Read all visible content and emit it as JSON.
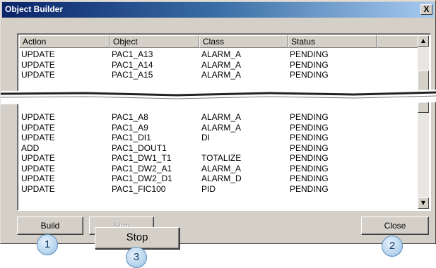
{
  "window": {
    "title": "Object Builder",
    "close_glyph": "X"
  },
  "columns": [
    "Action",
    "Object",
    "Class",
    "Status",
    ""
  ],
  "rows_top": [
    [
      "UPDATE",
      "PAC1_A13",
      "ALARM_A",
      "PENDING"
    ],
    [
      "UPDATE",
      "PAC1_A14",
      "ALARM_A",
      "PENDING"
    ],
    [
      "UPDATE",
      "PAC1_A15",
      "ALARM_A",
      "PENDING"
    ]
  ],
  "rows_bottom": [
    [
      "UPDATE",
      "PAC1_A8",
      "ALARM_A",
      "PENDING"
    ],
    [
      "UPDATE",
      "PAC1_A9",
      "ALARM_A",
      "PENDING"
    ],
    [
      "UPDATE",
      "PAC1_DI1",
      "DI",
      "PENDING"
    ],
    [
      "ADD",
      "PAC1_DOUT1",
      "",
      "PENDING"
    ],
    [
      "UPDATE",
      "PAC1_DW1_T1",
      "TOTALIZE",
      "PENDING"
    ],
    [
      "UPDATE",
      "PAC1_DW2_A1",
      "ALARM_A",
      "PENDING"
    ],
    [
      "UPDATE",
      "PAC1_DW2_D1",
      "ALARM_D",
      "PENDING"
    ],
    [
      "UPDATE",
      "PAC1_FIC100",
      "PID",
      "PENDING"
    ]
  ],
  "buttons": {
    "build": "Build",
    "stop_small": "Stop",
    "stop_callout": "Stop",
    "close": "Close"
  },
  "callouts": {
    "one": "1",
    "two": "2",
    "three": "3"
  },
  "icons": {
    "scroll_up": "scroll-up-arrow-icon",
    "scroll_down": "scroll-down-arrow-icon"
  },
  "colors": {
    "titlebar_start": "#0a246a",
    "face": "#d4d0c8",
    "badge": "#b9d6ef"
  }
}
